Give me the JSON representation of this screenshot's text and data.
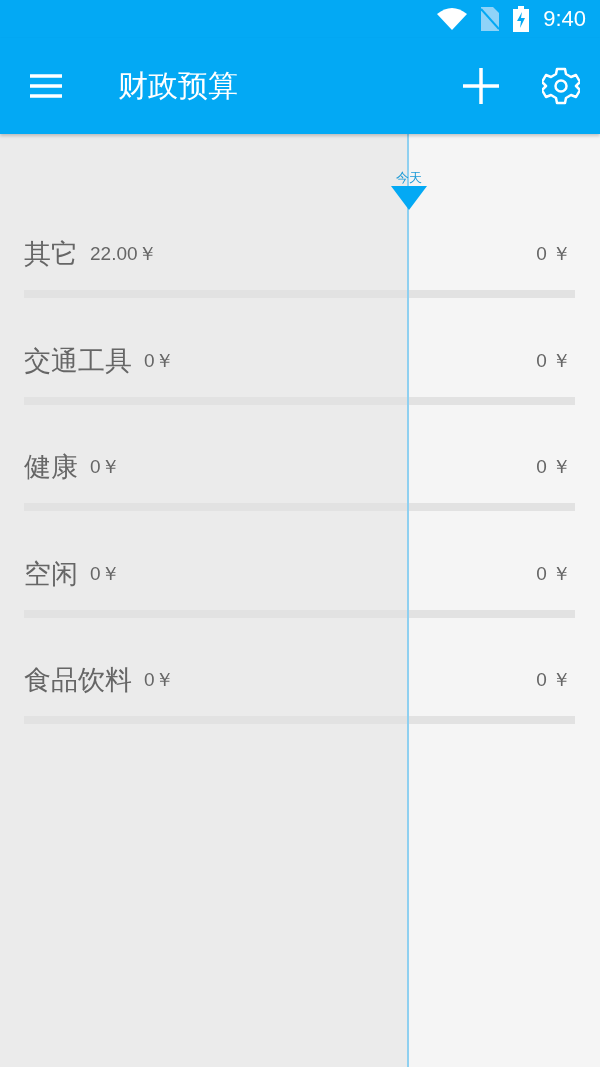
{
  "status_bar": {
    "time": "9:40"
  },
  "app_bar": {
    "title": "财政预算"
  },
  "today_marker": {
    "label": "今天"
  },
  "categories": [
    {
      "name": "其它",
      "spent": "22.00￥",
      "remaining": "0 ￥",
      "level": 0
    },
    {
      "name": "交通工具",
      "spent": "0￥",
      "remaining": "0 ￥",
      "level": 0
    },
    {
      "name": "健康",
      "spent": "0￥",
      "remaining": "0 ￥",
      "level": 0
    },
    {
      "name": "空闲",
      "spent": "0￥",
      "remaining": "0 ￥",
      "level": 0
    },
    {
      "name": "食品饮料",
      "spent": "0￥",
      "remaining": "0 ￥",
      "level": 0
    }
  ]
}
